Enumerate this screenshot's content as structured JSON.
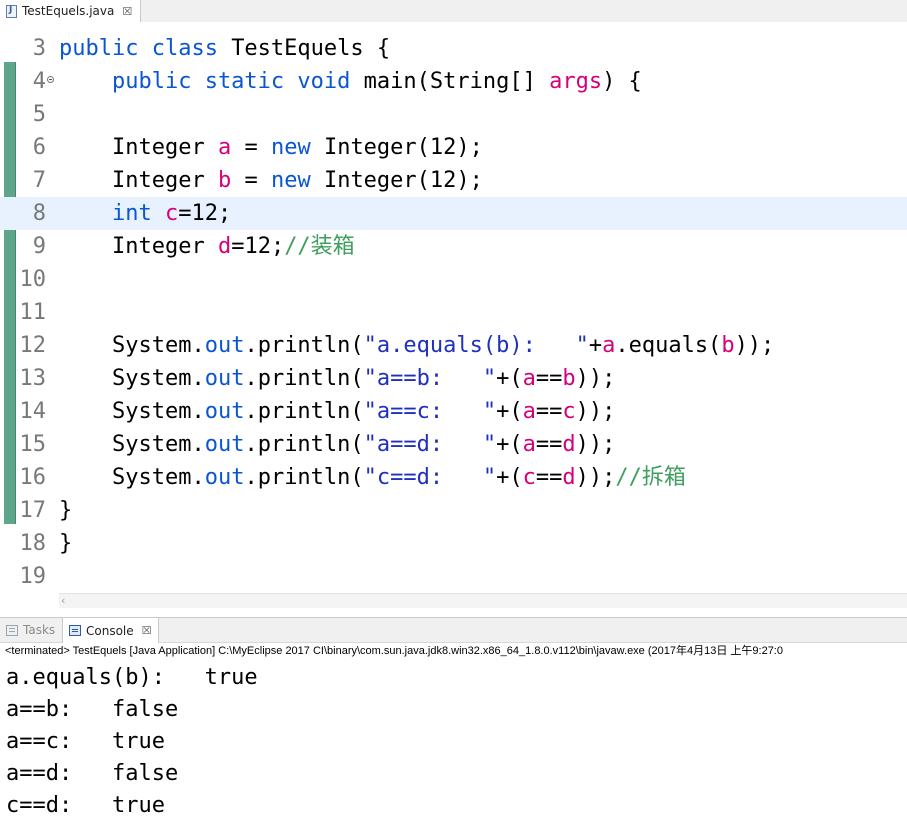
{
  "editor_tab": {
    "label": "TestEquels.java",
    "close": "☒"
  },
  "code_lines": [
    {
      "no": "3",
      "fold": false,
      "current": false,
      "tokens": [
        {
          "t": "public class ",
          "c": "blue"
        },
        {
          "t": "TestEquels {",
          "c": ""
        }
      ]
    },
    {
      "no": "4",
      "fold": true,
      "current": false,
      "tokens": [
        {
          "t": "    public static void ",
          "c": "blue"
        },
        {
          "t": "main(String[] ",
          "c": ""
        },
        {
          "t": "args",
          "c": "var"
        },
        {
          "t": ") {",
          "c": ""
        }
      ]
    },
    {
      "no": "5",
      "fold": false,
      "current": false,
      "tokens": []
    },
    {
      "no": "6",
      "fold": false,
      "current": false,
      "tokens": [
        {
          "t": "    Integer ",
          "c": ""
        },
        {
          "t": "a",
          "c": "var"
        },
        {
          "t": " = ",
          "c": ""
        },
        {
          "t": "new",
          "c": "blue"
        },
        {
          "t": " Integer(12);",
          "c": ""
        }
      ]
    },
    {
      "no": "7",
      "fold": false,
      "current": false,
      "tokens": [
        {
          "t": "    Integer ",
          "c": ""
        },
        {
          "t": "b",
          "c": "var"
        },
        {
          "t": " = ",
          "c": ""
        },
        {
          "t": "new",
          "c": "blue"
        },
        {
          "t": " Integer(12);",
          "c": ""
        }
      ]
    },
    {
      "no": "8",
      "fold": false,
      "current": true,
      "tokens": [
        {
          "t": "    ",
          "c": ""
        },
        {
          "t": "int",
          "c": "blue"
        },
        {
          "t": " ",
          "c": ""
        },
        {
          "t": "c",
          "c": "var"
        },
        {
          "t": "=12;",
          "c": ""
        }
      ]
    },
    {
      "no": "9",
      "fold": false,
      "current": false,
      "tokens": [
        {
          "t": "    Integer ",
          "c": ""
        },
        {
          "t": "d",
          "c": "var"
        },
        {
          "t": "=12;",
          "c": ""
        },
        {
          "t": "//装箱",
          "c": "cmt"
        }
      ]
    },
    {
      "no": "10",
      "fold": false,
      "current": false,
      "tokens": []
    },
    {
      "no": "11",
      "fold": false,
      "current": false,
      "tokens": []
    },
    {
      "no": "12",
      "fold": false,
      "current": false,
      "tokens": [
        {
          "t": "    System.",
          "c": ""
        },
        {
          "t": "out",
          "c": "blue"
        },
        {
          "t": ".println(",
          "c": ""
        },
        {
          "t": "\"a.equals(b):   \"",
          "c": "str"
        },
        {
          "t": "+",
          "c": ""
        },
        {
          "t": "a",
          "c": "var"
        },
        {
          "t": ".equals(",
          "c": ""
        },
        {
          "t": "b",
          "c": "var"
        },
        {
          "t": "));",
          "c": ""
        }
      ]
    },
    {
      "no": "13",
      "fold": false,
      "current": false,
      "tokens": [
        {
          "t": "    System.",
          "c": ""
        },
        {
          "t": "out",
          "c": "blue"
        },
        {
          "t": ".println(",
          "c": ""
        },
        {
          "t": "\"a==b:   \"",
          "c": "str"
        },
        {
          "t": "+(",
          "c": ""
        },
        {
          "t": "a",
          "c": "var"
        },
        {
          "t": "==",
          "c": ""
        },
        {
          "t": "b",
          "c": "var"
        },
        {
          "t": "));",
          "c": ""
        }
      ]
    },
    {
      "no": "14",
      "fold": false,
      "current": false,
      "tokens": [
        {
          "t": "    System.",
          "c": ""
        },
        {
          "t": "out",
          "c": "blue"
        },
        {
          "t": ".println(",
          "c": ""
        },
        {
          "t": "\"a==c:   \"",
          "c": "str"
        },
        {
          "t": "+(",
          "c": ""
        },
        {
          "t": "a",
          "c": "var"
        },
        {
          "t": "==",
          "c": ""
        },
        {
          "t": "c",
          "c": "var"
        },
        {
          "t": "));",
          "c": ""
        }
      ]
    },
    {
      "no": "15",
      "fold": false,
      "current": false,
      "tokens": [
        {
          "t": "    System.",
          "c": ""
        },
        {
          "t": "out",
          "c": "blue"
        },
        {
          "t": ".println(",
          "c": ""
        },
        {
          "t": "\"a==d:   \"",
          "c": "str"
        },
        {
          "t": "+(",
          "c": ""
        },
        {
          "t": "a",
          "c": "var"
        },
        {
          "t": "==",
          "c": ""
        },
        {
          "t": "d",
          "c": "var"
        },
        {
          "t": "));",
          "c": ""
        }
      ]
    },
    {
      "no": "16",
      "fold": false,
      "current": false,
      "tokens": [
        {
          "t": "    System.",
          "c": ""
        },
        {
          "t": "out",
          "c": "blue"
        },
        {
          "t": ".println(",
          "c": ""
        },
        {
          "t": "\"c==d:   \"",
          "c": "str"
        },
        {
          "t": "+(",
          "c": ""
        },
        {
          "t": "c",
          "c": "var"
        },
        {
          "t": "==",
          "c": ""
        },
        {
          "t": "d",
          "c": "var"
        },
        {
          "t": "));",
          "c": ""
        },
        {
          "t": "//拆箱",
          "c": "cmt"
        }
      ]
    },
    {
      "no": "17",
      "fold": false,
      "current": false,
      "tokens": [
        {
          "t": "}",
          "c": ""
        }
      ]
    },
    {
      "no": "18",
      "fold": false,
      "current": false,
      "tokens": [
        {
          "t": "}",
          "c": ""
        }
      ]
    },
    {
      "no": "19",
      "fold": false,
      "current": false,
      "tokens": []
    }
  ],
  "scrollbar": {
    "left_arrow": "‹"
  },
  "console_tabs": {
    "tasks_label": "Tasks",
    "console_label": "Console",
    "close": "☒"
  },
  "console": {
    "terminated": "<terminated> TestEquels [Java Application] C:\\MyEclipse 2017 CI\\binary\\com.sun.java.jdk8.win32.x86_64_1.8.0.v112\\bin\\javaw.exe (2017年4月13日 上午9:27:0",
    "output": [
      "a.equals(b):   true",
      "a==b:   false",
      "a==c:   true",
      "a==d:   false",
      "c==d:   true"
    ]
  },
  "colors": {
    "keyword": "#0a56d2",
    "variable": "#d6007a",
    "string": "#1f2fbf",
    "comment": "#3f9f5f",
    "current_line": "#e8f2fe",
    "change_bar": "#5fa58a"
  }
}
